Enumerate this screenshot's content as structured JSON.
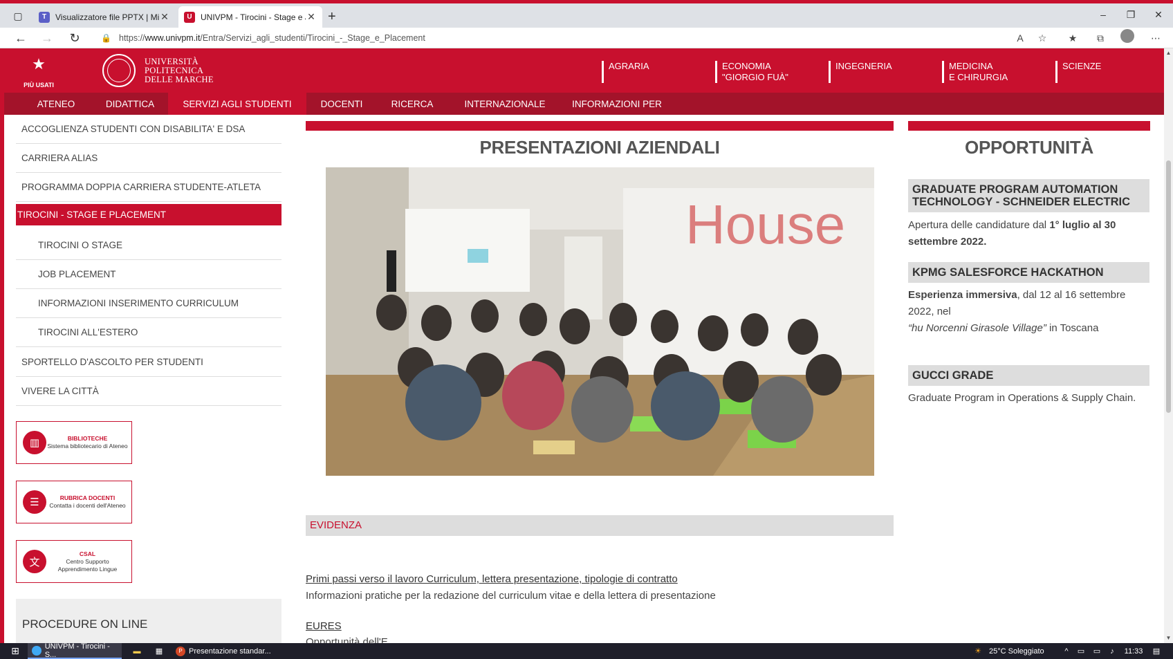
{
  "browser": {
    "tabs": [
      {
        "title": "Visualizzatore file PPTX | Micros"
      },
      {
        "title": "UNIVPM - Tirocini - Stage e Job"
      }
    ],
    "url_prefix": "https://",
    "url_host": "www.univpm.it",
    "url_path": "/Entra/Servizi_agli_studenti/Tirocini_-_Stage_e_Placement"
  },
  "header": {
    "most_used": "PIÙ USATI",
    "logo_lines": [
      "UNIVERSITÀ",
      "POLITECNICA",
      "DELLE MARCHE"
    ],
    "faculties": [
      {
        "line1": "AGRARIA",
        "line2": ""
      },
      {
        "line1": "ECONOMIA",
        "line2": "\"GIORGIO FUÀ\""
      },
      {
        "line1": "INGEGNERIA",
        "line2": ""
      },
      {
        "line1": "MEDICINA",
        "line2": "E CHIRURGIA"
      },
      {
        "line1": "SCIENZE",
        "line2": ""
      }
    ]
  },
  "menu": [
    "ATENEO",
    "DIDATTICA",
    "SERVIZI AGLI STUDENTI",
    "DOCENTI",
    "RICERCA",
    "INTERNAZIONALE",
    "INFORMAZIONI PER"
  ],
  "sidebar": {
    "links": [
      "ACCOGLIENZA STUDENTI CON DISABILITA' E DSA",
      "CARRIERA ALIAS",
      "PROGRAMMA DOPPIA CARRIERA STUDENTE-ATLETA",
      "TIROCINI - STAGE E PLACEMENT",
      "TIROCINI O STAGE",
      "JOB PLACEMENT",
      "INFORMAZIONI INSERIMENTO CURRICULUM",
      "TIROCINI ALL'ESTERO",
      "SPORTELLO D'ASCOLTO PER STUDENTI",
      "VIVERE LA CITTÀ"
    ],
    "boxes": [
      {
        "title": "BIBLIOTECHE",
        "sub": "Sistema bibliotecario di Ateneo"
      },
      {
        "title": "RUBRICA DOCENTI",
        "sub": "Contatta i docenti dell'Ateneo"
      },
      {
        "title": "CSAL",
        "sub": "Centro Supporto Apprendimento Lingue"
      }
    ],
    "procedure_title": "PROCEDURE ON LINE"
  },
  "center": {
    "title": "PRESENTAZIONI AZIENDALI",
    "photo_sign": "House",
    "evidenza": "EVIDENZA",
    "link1": "Primi passi verso il lavoro Curriculum, lettera presentazione, tipologie di contratto",
    "desc1": "Informazioni pratiche per la redazione del curriculum vitae e della lettera di presentazione",
    "link2": "EURES",
    "desc2": "Opportunità dell'E"
  },
  "right": {
    "title": "OPPORTUNITÀ",
    "items": [
      {
        "head": "GRADUATE PROGRAM AUTOMATION TECHNOLOGY - SCHNEIDER ELECTRIC",
        "text_a": "Apertura delle candidature dal ",
        "text_b": "1° luglio al 30 settembre 2022."
      },
      {
        "head": "KPMG SALESFORCE HACKATHON",
        "text_a": "Esperienza immersiva",
        "text_b": ", dal 12 al 16 settembre 2022, nel",
        "text_c": "“hu Norcenni Girasole Village”",
        "text_d": " in Toscana"
      },
      {
        "head": "GUCCI GRADE",
        "text_a": "Graduate Program in Operations & Supply Chain."
      }
    ]
  },
  "taskbar": {
    "app1": "UNIVPM - Tirocini - S...",
    "app2": "Presentazione standar...",
    "weather": "25°C  Soleggiato",
    "time": "11:33"
  },
  "colors": {
    "brand": "#c8102e",
    "menu": "#a3132a"
  }
}
